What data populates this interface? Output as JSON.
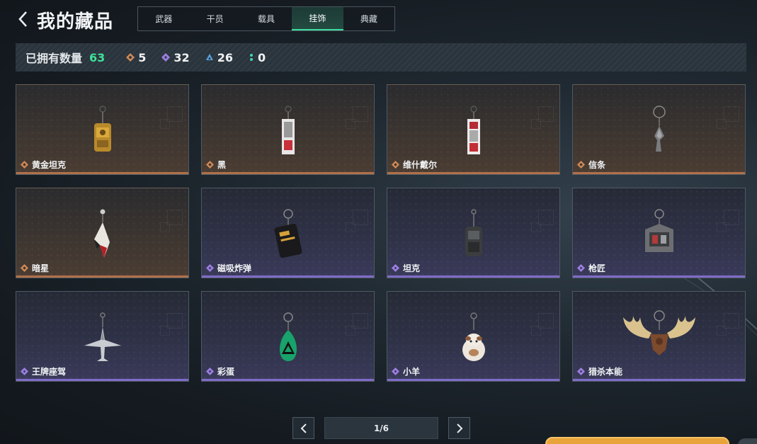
{
  "header": {
    "title": "我的藏品",
    "tabs": [
      {
        "label": "武器",
        "active": false
      },
      {
        "label": "干员",
        "active": false
      },
      {
        "label": "载具",
        "active": false
      },
      {
        "label": "挂饰",
        "active": true
      },
      {
        "label": "典藏",
        "active": false
      }
    ]
  },
  "stats": {
    "label": "已拥有数量",
    "total": "63",
    "counts": [
      {
        "icon": "gold-diamond-icon",
        "value": "5",
        "color": "#d08a57"
      },
      {
        "icon": "purple-diamond-icon",
        "value": "32",
        "color": "#9b7fe0"
      },
      {
        "icon": "blue-triangle-icon",
        "value": "26",
        "color": "#5aa6e6"
      },
      {
        "icon": "green-dots-icon",
        "value": "0",
        "color": "#45d6a8"
      }
    ]
  },
  "items": [
    {
      "name": "黄金坦克",
      "rarity": "gold"
    },
    {
      "name": "黑",
      "rarity": "gold"
    },
    {
      "name": "维什戴尔",
      "rarity": "gold"
    },
    {
      "name": "信条",
      "rarity": "gold"
    },
    {
      "name": "暗星",
      "rarity": "gold"
    },
    {
      "name": "磁吸炸弹",
      "rarity": "purple"
    },
    {
      "name": "坦克",
      "rarity": "purple"
    },
    {
      "name": "枪匠",
      "rarity": "purple"
    },
    {
      "name": "王牌座驾",
      "rarity": "purple"
    },
    {
      "name": "彩蛋",
      "rarity": "purple"
    },
    {
      "name": "小羊",
      "rarity": "purple"
    },
    {
      "name": "猎杀本能",
      "rarity": "purple"
    }
  ],
  "pagination": {
    "label": "1/6"
  },
  "colors": {
    "accent_green": "#3ee29a",
    "gold": "#b1714a",
    "purple": "#7f6cc8"
  }
}
